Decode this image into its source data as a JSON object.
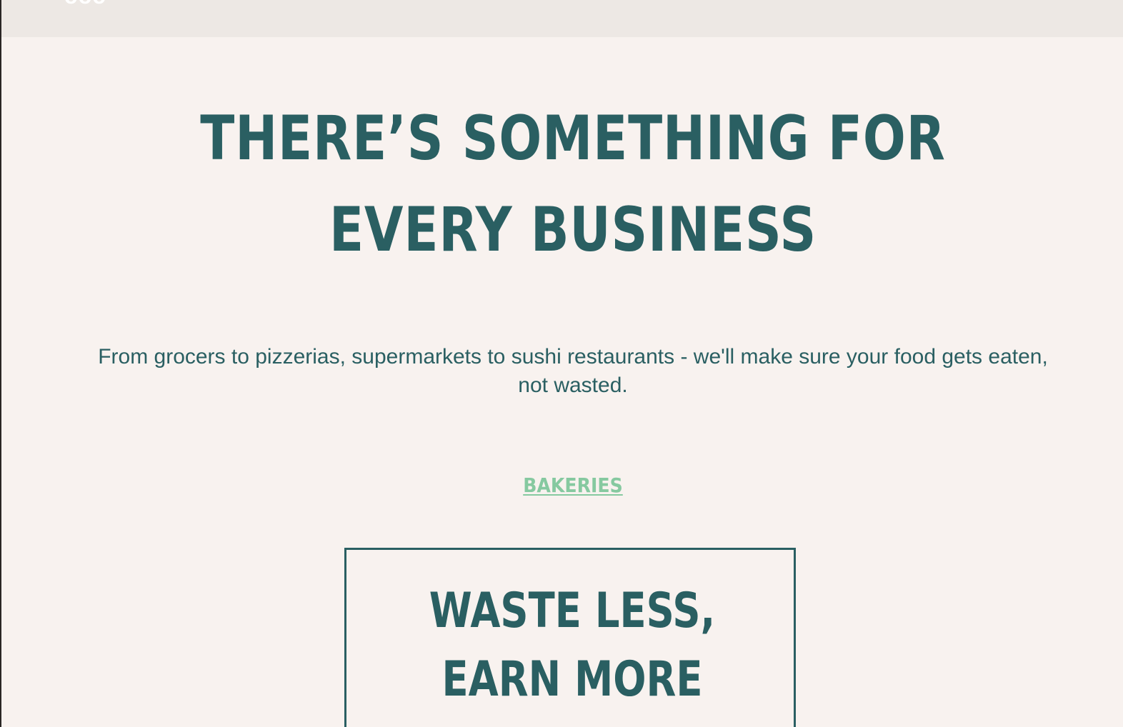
{
  "header": {
    "logo_text": "OOO"
  },
  "hero": {
    "title": "THERE’S SOMETHING FOR EVERY BUSINESS",
    "subtitle": "From grocers to pizzerias, supermarkets to sushi restaurants - we'll make sure your food gets eaten, not wasted."
  },
  "category": {
    "link_label": "BAKERIES"
  },
  "card": {
    "title": "WASTE LESS, EARN MORE"
  },
  "colors": {
    "brand_teal": "#2a5f62",
    "accent_green": "#86c9a0",
    "background": "#f8f2ef",
    "header_background": "#ede8e4"
  }
}
